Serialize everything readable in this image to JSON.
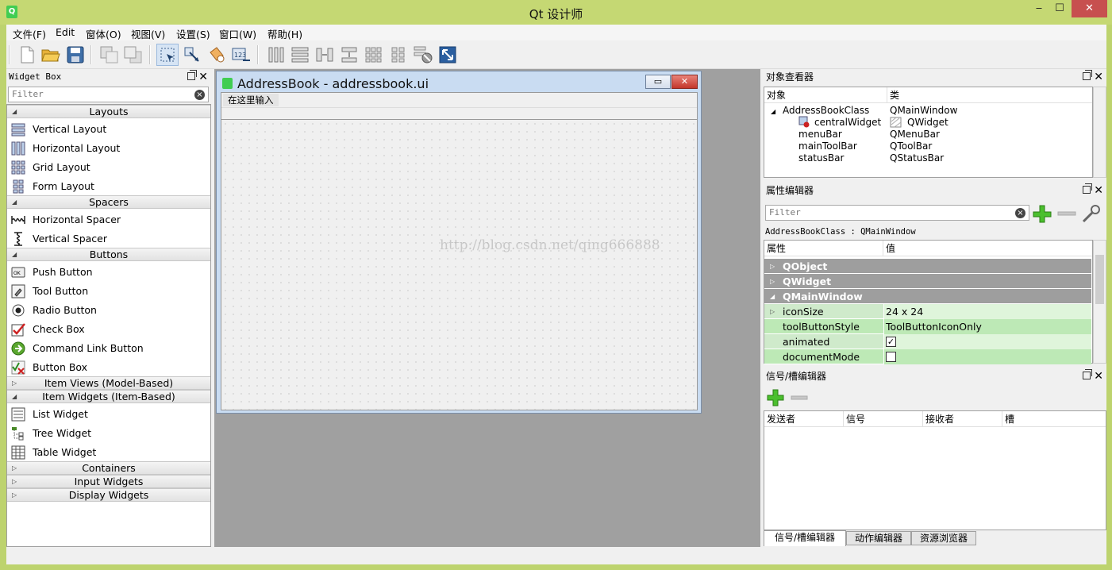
{
  "window": {
    "title": "Qt 设计师",
    "min": "‒",
    "max": "☐",
    "close": "✕"
  },
  "menubar": [
    "文件(F)",
    "Edit",
    "窗体(O)",
    "视图(V)",
    "设置(S)",
    "窗口(W)",
    "帮助(H)"
  ],
  "widget_box": {
    "title": "Widget Box",
    "filter_placeholder": "Filter",
    "categories": {
      "layouts": "Layouts",
      "spacers": "Spacers",
      "buttons": "Buttons",
      "item_views": "Item Views (Model-Based)",
      "item_widgets": "Item Widgets (Item-Based)",
      "containers": "Containers",
      "input_widgets": "Input Widgets",
      "display_widgets": "Display Widgets"
    },
    "items": {
      "vertical_layout": "Vertical Layout",
      "horizontal_layout": "Horizontal Layout",
      "grid_layout": "Grid Layout",
      "form_layout": "Form Layout",
      "horizontal_spacer": "Horizontal Spacer",
      "vertical_spacer": "Vertical Spacer",
      "push_button": "Push Button",
      "tool_button": "Tool Button",
      "radio_button": "Radio Button",
      "check_box": "Check Box",
      "command_link_button": "Command Link Button",
      "button_box": "Button Box",
      "list_widget": "List Widget",
      "tree_widget": "Tree Widget",
      "table_widget": "Table Widget"
    }
  },
  "form": {
    "title": "AddressBook - addressbook.ui",
    "menu_placeholder": "在这里输入",
    "watermark": "http://blog.csdn.net/qing666888"
  },
  "object_inspector": {
    "title": "对象查看器",
    "col_object": "对象",
    "col_class": "类",
    "rows": [
      {
        "name": "AddressBookClass",
        "cls": "QMainWindow"
      },
      {
        "name": "centralWidget",
        "cls": "QWidget"
      },
      {
        "name": "menuBar",
        "cls": "QMenuBar"
      },
      {
        "name": "mainToolBar",
        "cls": "QToolBar"
      },
      {
        "name": "statusBar",
        "cls": "QStatusBar"
      }
    ]
  },
  "property_editor": {
    "title": "属性编辑器",
    "filter_placeholder": "Filter",
    "context": "AddressBookClass : QMainWindow",
    "col_property": "属性",
    "col_value": "值",
    "groups": [
      "QObject",
      "QWidget",
      "QMainWindow"
    ],
    "props": [
      {
        "name": "iconSize",
        "value": "24 x 24"
      },
      {
        "name": "toolButtonStyle",
        "value": "ToolButtonIconOnly"
      },
      {
        "name": "animated",
        "checked": true
      },
      {
        "name": "documentMode",
        "checked": false
      }
    ]
  },
  "signal_slot": {
    "title": "信号/槽编辑器",
    "col_sender": "发送者",
    "col_signal": "信号",
    "col_receiver": "接收者",
    "col_slot": "槽"
  },
  "tabs": [
    "信号/槽编辑器",
    "动作编辑器",
    "资源浏览器"
  ],
  "colors": {
    "accent_green": "#41cd52",
    "title_bg": "#c5d873",
    "close_red": "#c7504f"
  }
}
